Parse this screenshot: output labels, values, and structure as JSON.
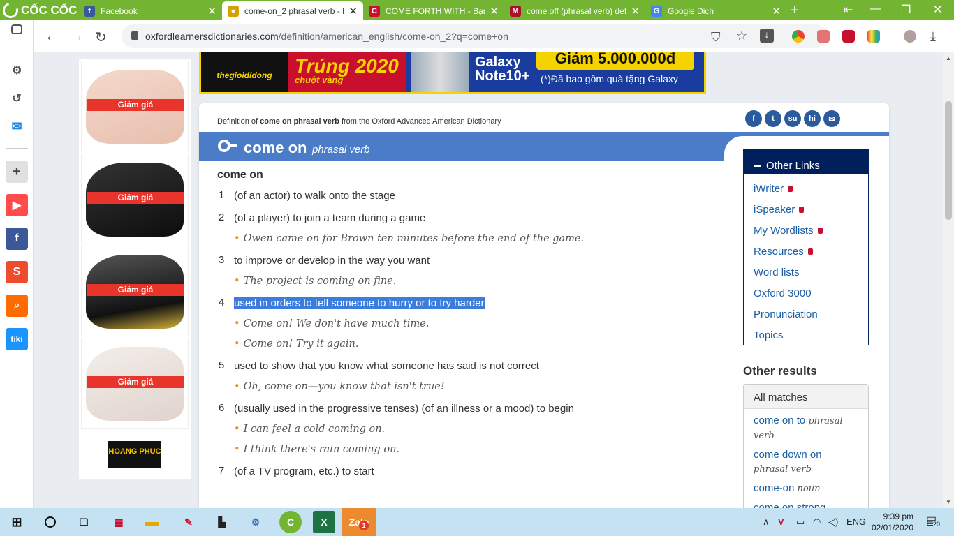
{
  "browser": {
    "brand": "CỐC CỐC",
    "tabs": [
      {
        "title": "Facebook",
        "active": false,
        "favicon": "facebook-icon",
        "color": "#3b5998"
      },
      {
        "title": "come-on_2 phrasal verb - D",
        "active": true,
        "favicon": "oxford-icon",
        "color": "#d6a000"
      },
      {
        "title": "COME FORTH WITH - Bạn d",
        "active": false,
        "favicon": "cambridge-icon",
        "color": "#c8102e"
      },
      {
        "title": "come off (phrasal verb) defi",
        "active": false,
        "favicon": "macmillan-icon",
        "color": "#a8102e"
      },
      {
        "title": "Google Dịch",
        "active": false,
        "favicon": "google-translate-icon",
        "color": "#4285f4"
      }
    ],
    "url_host": "oxfordlearnersdictionaries.com",
    "url_path": "/definition/american_english/come-on_2?q=come+on"
  },
  "ads": {
    "sale_label": "Giảm giá",
    "partner_logo": "HOANG PHUC"
  },
  "banner": {
    "store": "thegioididong",
    "promo": "Trúng 2020",
    "promo_sub": "chuột vàng",
    "device": "Galaxy Note10+",
    "discount": "Giảm 5.000.000đ",
    "note": "(*)Đã bao gồm quà tặng Galaxy"
  },
  "dictionary": {
    "source_prefix": "Definition of",
    "source_term": "come on phrasal verb",
    "source_suffix": "from the Oxford Advanced American Dictionary",
    "headword": "come on",
    "pos": "phrasal verb",
    "entry_heading": "come on",
    "senses": [
      {
        "num": "1",
        "def": "(of an actor) to walk onto the stage",
        "examples": [],
        "highlight": false
      },
      {
        "num": "2",
        "def": "(of a player) to join a team during a game",
        "examples": [
          "Owen came on for Brown ten minutes before the end of the game."
        ],
        "highlight": false
      },
      {
        "num": "3",
        "def": "to improve or develop in the way you want",
        "examples": [
          "The project is coming on fine."
        ],
        "highlight": false
      },
      {
        "num": "4",
        "def": "used in orders to tell someone to hurry or to try harder",
        "examples": [
          "Come on! We don't have much time.",
          "Come on! Try it again."
        ],
        "highlight": true
      },
      {
        "num": "5",
        "def": "used to show that you know what someone has said is not correct",
        "examples": [
          "Oh, come on—you know that isn't true!"
        ],
        "highlight": false
      },
      {
        "num": "6",
        "def": "(usually used in the progressive tenses) (of an illness or a mood) to begin",
        "examples": [
          "I can feel a cold coming on.",
          "I think there's rain coming on."
        ],
        "highlight": false
      },
      {
        "num": "7",
        "def": "(of a TV program, etc.) to start",
        "examples": [],
        "highlight": false
      }
    ]
  },
  "sidebar": {
    "other_links_title": "Other Links",
    "links": [
      {
        "label": "iWriter",
        "locked": true
      },
      {
        "label": "iSpeaker",
        "locked": true
      },
      {
        "label": "My Wordlists",
        "locked": true
      },
      {
        "label": "Resources",
        "locked": true
      },
      {
        "label": "Word lists",
        "locked": false
      },
      {
        "label": "Oxford 3000",
        "locked": false
      },
      {
        "label": "Pronunciation",
        "locked": false
      },
      {
        "label": "Topics",
        "locked": false
      }
    ],
    "other_results_title": "Other results",
    "all_matches": "All matches",
    "results": [
      {
        "term": "come on to",
        "pos": "phrasal verb"
      },
      {
        "term": "come down on",
        "pos": "phrasal verb"
      },
      {
        "term": "come-on",
        "pos": "noun"
      },
      {
        "term": "come on strong",
        "pos": ""
      }
    ]
  },
  "taskbar": {
    "language": "ENG",
    "time": "9:39 pm",
    "date": "02/01/2020",
    "notification_count": "20",
    "zalo_badge": "1"
  },
  "colors": {
    "browser_green": "#73b432",
    "oxford_blue": "#4a7cc7",
    "oxford_navy": "#00205b",
    "link_blue": "#1a5ea6",
    "highlight": "#3b7ddd",
    "bullet": "#d99a2b"
  }
}
